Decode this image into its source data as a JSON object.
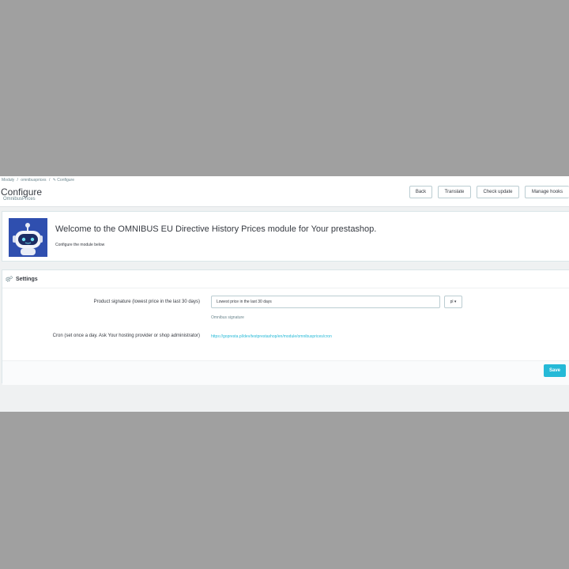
{
  "breadcrumb": [
    "Moduły",
    "/",
    "omnibusprices",
    "/",
    "✎ Configure"
  ],
  "page": {
    "title": "Configure",
    "subtitle": "OmnibusPrices"
  },
  "toolbar": {
    "back": "Back",
    "translate": "Translate",
    "check_update": "Check update",
    "manage_hooks": "Manage hooks"
  },
  "welcome": {
    "title": "Welcome to the OMNIBUS EU Directive History Prices module for Your prestashop.",
    "subtitle": "Configure the module below",
    "logo_icon": "robot-icon"
  },
  "settings": {
    "title": "Settings",
    "icon": "gears-icon",
    "signature_label": "Product signature (lowest price in the last 30 days)",
    "signature_value": "Lowest price in the last 30 days",
    "language": "pl ▾",
    "signature_help": "Omnibus signature",
    "cron_label": "Cron (set once a day. Ask Your hosting provider or shop administrator)",
    "cron_url": "https://gopresta.pl/dev/testprestashop/en/module/omnibusprices/cron"
  },
  "footer": {
    "save": "Save"
  },
  "colors": {
    "accent": "#25b9d7",
    "logo_bg": "#2f4faf"
  }
}
